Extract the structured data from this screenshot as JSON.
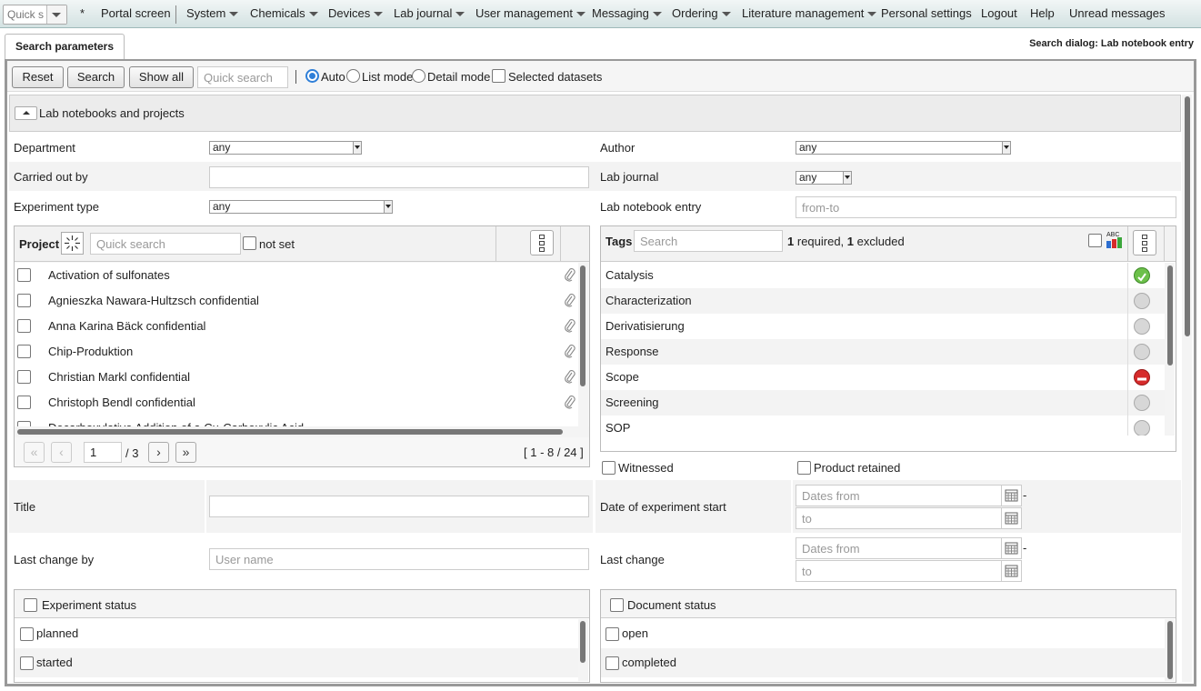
{
  "topbar": {
    "quick_search_placeholder": "Quick s",
    "star": "*",
    "items": [
      "Portal screen",
      "System",
      "Chemicals",
      "Devices",
      "Lab journal",
      "User management",
      "Messaging",
      "Ordering",
      "Literature management",
      "Personal settings",
      "Logout",
      "Help",
      "Unread messages"
    ]
  },
  "tab": {
    "label": "Search parameters"
  },
  "dialog_title": "Search dialog: Lab notebook entry",
  "toolbar": {
    "reset": "Reset",
    "search": "Search",
    "show_all": "Show all",
    "quick_search_placeholder": "Quick search",
    "modes": [
      "Auto",
      "List mode",
      "Detail mode"
    ],
    "selected_mode": "Auto",
    "selected_datasets": "Selected datasets"
  },
  "section": {
    "title": "Lab notebooks and projects"
  },
  "fields": {
    "department": {
      "label": "Department",
      "value": "any"
    },
    "author": {
      "label": "Author",
      "value": "any"
    },
    "carried_out_by": {
      "label": "Carried out by",
      "value": ""
    },
    "lab_journal": {
      "label": "Lab journal",
      "value": "any"
    },
    "experiment_type": {
      "label": "Experiment type",
      "value": "any"
    },
    "lab_notebook_entry": {
      "label": "Lab notebook entry",
      "placeholder": "from-to"
    },
    "title": {
      "label": "Title",
      "value": ""
    },
    "date_start": {
      "label": "Date of experiment start",
      "from_placeholder": "Dates from",
      "to_placeholder": "to",
      "dash": "-"
    },
    "last_change_by": {
      "label": "Last change by",
      "placeholder": "User name"
    },
    "last_change": {
      "label": "Last change",
      "from_placeholder": "Dates from",
      "to_placeholder": "to",
      "dash": "-"
    },
    "witnessed": "Witnessed",
    "product_retained": "Product retained"
  },
  "project_panel": {
    "title": "Project",
    "search_placeholder": "Quick search",
    "not_set": "not set",
    "items": [
      "Activation of sulfonates",
      "Agnieszka Nawara-Hultzsch confidential",
      "Anna Karina Bäck confidential",
      "Chip-Produktion",
      "Christian Markl confidential",
      "Christoph Bendl confidential",
      "Decarboxylative Addition of a Cu-Carboxylic Acid"
    ],
    "page": "1",
    "page_total": "/ 3",
    "range": "[ 1 - 8 / 24 ]"
  },
  "tags_panel": {
    "title": "Tags",
    "search_placeholder": "Search",
    "required_count": "1",
    "required_text": "required,",
    "excluded_count": "1",
    "excluded_text": "excluded",
    "abc": "ABC",
    "items": [
      {
        "name": "Catalysis",
        "state": "required"
      },
      {
        "name": "Characterization",
        "state": "none"
      },
      {
        "name": "Derivatisierung",
        "state": "none"
      },
      {
        "name": "Response",
        "state": "none"
      },
      {
        "name": "Scope",
        "state": "excluded"
      },
      {
        "name": "Screening",
        "state": "none"
      },
      {
        "name": "SOP",
        "state": "none"
      }
    ]
  },
  "experiment_status": {
    "title": "Experiment status",
    "items": [
      "planned",
      "started"
    ]
  },
  "document_status": {
    "title": "Document status",
    "items": [
      "open",
      "completed"
    ]
  },
  "colors": {
    "accent": "#2f7fd8",
    "required": "#6cc04a",
    "excluded": "#d62b2b",
    "topbar": "#d4e2e2"
  }
}
